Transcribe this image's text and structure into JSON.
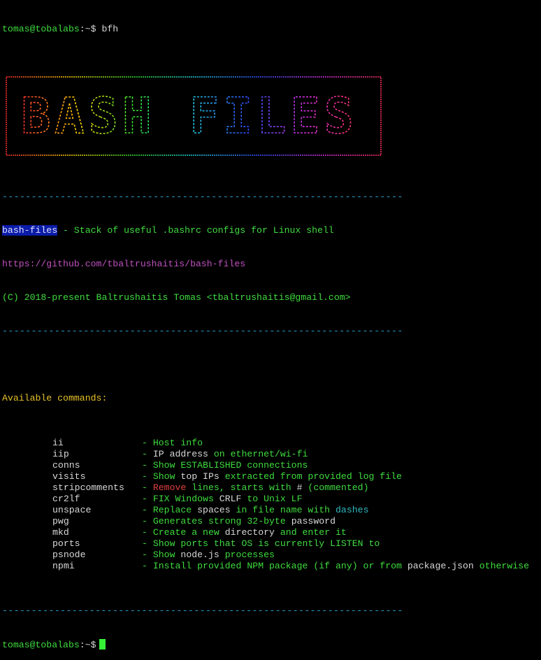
{
  "prompt": {
    "user_host": "tomas@tobalabs",
    "path": ":~",
    "symbol": "$",
    "command": "bfh"
  },
  "banner": {
    "text": "BASH FILES"
  },
  "separator": "---------------------------------------------------------------------",
  "info": {
    "name": "bash-files",
    "description": " - Stack of useful .bashrc configs for Linux shell",
    "url": "https://github.com/tbaltrushaitis/bash-files",
    "copyright": "(C) 2018-present Baltrushaitis Tomas <tbaltrushaitis@gmail.com>"
  },
  "available_title": "Available commands:",
  "commands": [
    {
      "name": "ii",
      "desc": [
        {
          "t": "Host info",
          "c": "green"
        }
      ]
    },
    {
      "name": "iip",
      "desc": [
        {
          "t": "IP address ",
          "c": "white"
        },
        {
          "t": "on ethernet/wi-fi",
          "c": "green"
        }
      ]
    },
    {
      "name": "conns",
      "desc": [
        {
          "t": "Show ESTABLISHED connections",
          "c": "green"
        }
      ]
    },
    {
      "name": "visits",
      "desc": [
        {
          "t": "Show ",
          "c": "green"
        },
        {
          "t": "top IPs ",
          "c": "white"
        },
        {
          "t": "extracted from provided log file",
          "c": "green"
        }
      ]
    },
    {
      "name": "stripcomments",
      "desc": [
        {
          "t": "Remove",
          "c": "red"
        },
        {
          "t": " lines, starts with ",
          "c": "green"
        },
        {
          "t": "#",
          "c": "white"
        },
        {
          "t": " (commented)",
          "c": "green"
        }
      ]
    },
    {
      "name": "cr2lf",
      "desc": [
        {
          "t": "FIX Windows ",
          "c": "green"
        },
        {
          "t": "CRLF",
          "c": "white"
        },
        {
          "t": " to ",
          "c": "green"
        },
        {
          "t": "Unix LF",
          "c": "green"
        }
      ]
    },
    {
      "name": "unspace",
      "desc": [
        {
          "t": "Replace ",
          "c": "green"
        },
        {
          "t": "spaces",
          "c": "white"
        },
        {
          "t": " in file name with ",
          "c": "green"
        },
        {
          "t": "dashes",
          "c": "cyan"
        }
      ]
    },
    {
      "name": "pwg",
      "desc": [
        {
          "t": "Generates strong 32-byte ",
          "c": "green"
        },
        {
          "t": "password",
          "c": "white"
        }
      ]
    },
    {
      "name": "mkd",
      "desc": [
        {
          "t": "Create a new ",
          "c": "green"
        },
        {
          "t": "directory",
          "c": "white"
        },
        {
          "t": " and enter it",
          "c": "green"
        }
      ]
    },
    {
      "name": "ports",
      "desc": [
        {
          "t": "Show ports that OS is currently LISTEN to",
          "c": "green"
        }
      ]
    },
    {
      "name": "psnode",
      "desc": [
        {
          "t": "Show ",
          "c": "green"
        },
        {
          "t": "node.js",
          "c": "white"
        },
        {
          "t": " processes",
          "c": "green"
        }
      ]
    },
    {
      "name": "npmi",
      "desc": [
        {
          "t": "Install provided NPM package (if any) or from ",
          "c": "green"
        },
        {
          "t": "package.json",
          "c": "white"
        },
        {
          "t": " otherwise",
          "c": "green"
        }
      ]
    }
  ],
  "colors": {
    "background": "#000000",
    "prompt_green": "#3fdc3f",
    "separator_blue": "#2a9fd0",
    "title_yellow": "#e6c229",
    "url_magenta": "#c050c0"
  }
}
